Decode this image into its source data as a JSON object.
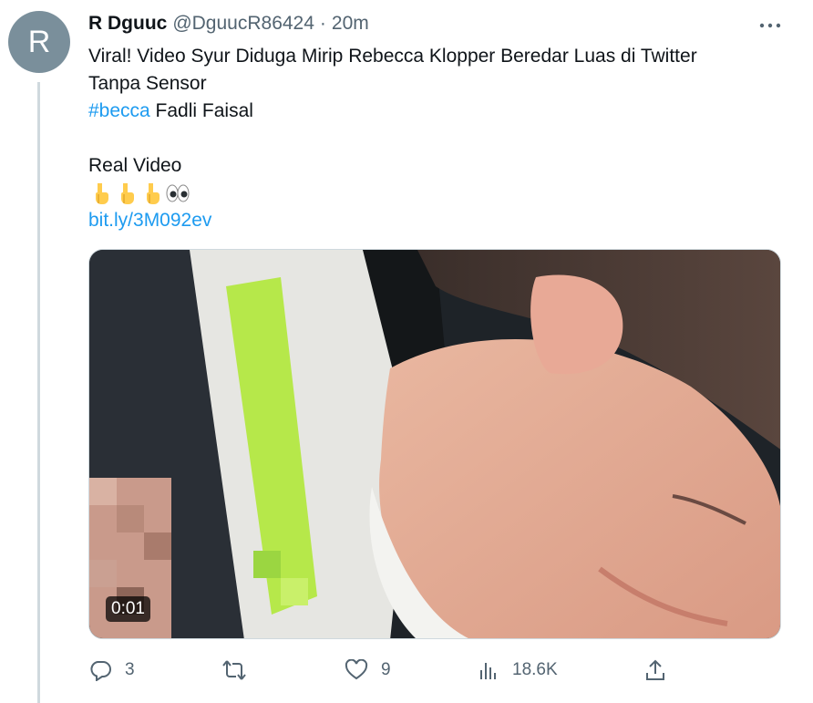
{
  "author": {
    "avatar_letter": "R",
    "name": "R Dguuc",
    "handle": "@DguucR86424",
    "separator": "·",
    "time": "20m"
  },
  "tweet": {
    "line1": "Viral! Video Syur Diduga Mirip Rebecca Klopper Beredar Luas di Twitter",
    "line2": "Tanpa Sensor",
    "hashtag": "#becca",
    "hashtag_rest": " Fadli Faisal",
    "line4": "Real Video",
    "emojis": [
      "pointing-down-emoji",
      "pointing-down-emoji",
      "pointing-down-emoji",
      "eyes-emoji"
    ],
    "link": "bit.ly/3M092ev"
  },
  "media": {
    "type": "video",
    "duration": "0:01"
  },
  "actions": {
    "replies": "3",
    "retweets": "",
    "likes": "9",
    "views": "18.6K"
  },
  "colors": {
    "link": "#1d9bf0",
    "muted": "#536471",
    "avatar_bg": "#7a8f9b"
  }
}
